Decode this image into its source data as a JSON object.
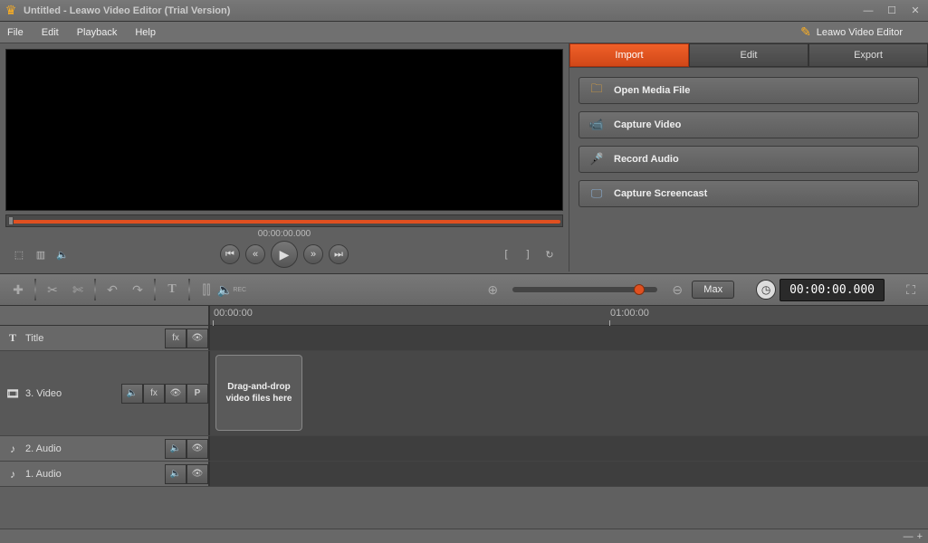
{
  "window": {
    "title": "Untitled - Leawo Video Editor (Trial Version)"
  },
  "brand": "Leawo Video Editor",
  "menu": {
    "file": "File",
    "edit": "Edit",
    "playback": "Playback",
    "help": "Help"
  },
  "preview": {
    "timecode": "00:00:00.000"
  },
  "tabs": {
    "import": "Import",
    "edit": "Edit",
    "export": "Export"
  },
  "actions": {
    "open": "Open Media File",
    "capture_video": "Capture Video",
    "record_audio": "Record Audio",
    "screencast": "Capture Screencast"
  },
  "toolbar": {
    "max": "Max",
    "timedisplay": "00:00:00.000"
  },
  "ruler": {
    "t0": "00:00:00",
    "t1": "01:00:00"
  },
  "tracks": {
    "title": "Title",
    "video": "3. Video",
    "audio2": "2. Audio",
    "audio1": "1. Audio",
    "dropzone": "Drag-and-drop video files here"
  }
}
